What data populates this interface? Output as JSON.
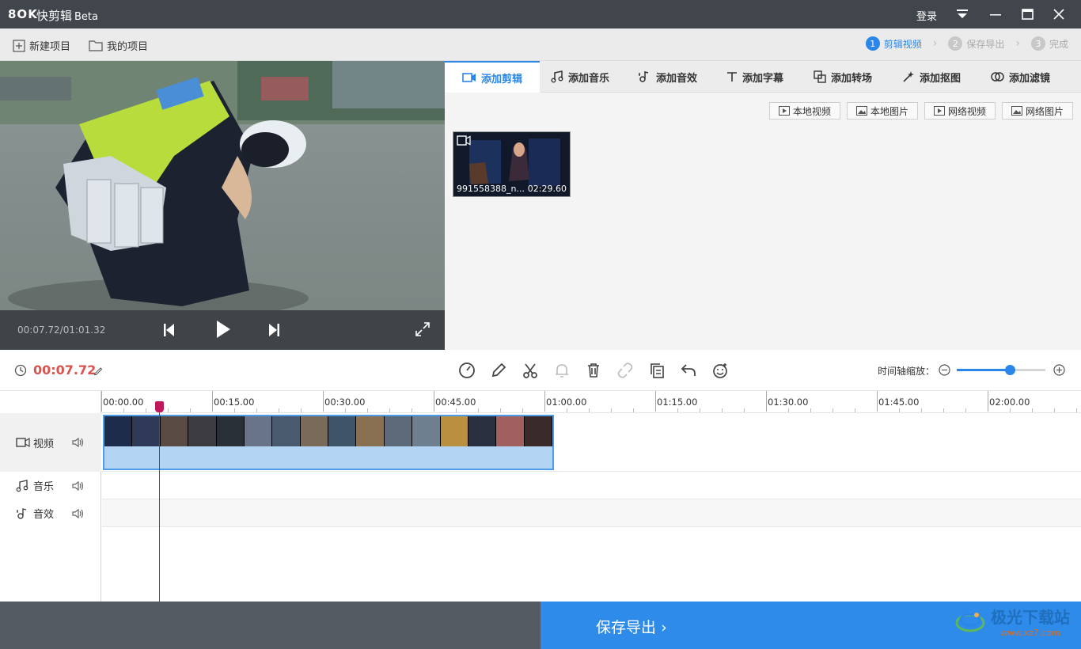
{
  "titlebar": {
    "logo": "8OK",
    "app_name": "快剪辑",
    "beta": "Beta",
    "login": "登录"
  },
  "menubar": {
    "new_project": "新建项目",
    "my_projects": "我的项目",
    "steps": [
      {
        "num": "1",
        "label": "剪辑视频"
      },
      {
        "num": "2",
        "label": "保存导出"
      },
      {
        "num": "3",
        "label": "完成"
      }
    ]
  },
  "preview": {
    "time": "00:07.72/01:01.32"
  },
  "tabs": [
    {
      "label": "添加剪辑",
      "icon": "video-camera-icon"
    },
    {
      "label": "添加音乐",
      "icon": "music-note-icon"
    },
    {
      "label": "添加音效",
      "icon": "sound-effect-icon"
    },
    {
      "label": "添加字幕",
      "icon": "text-icon"
    },
    {
      "label": "添加转场",
      "icon": "transition-icon"
    },
    {
      "label": "添加抠图",
      "icon": "magic-wand-icon"
    },
    {
      "label": "添加滤镜",
      "icon": "filter-icon"
    }
  ],
  "sources": {
    "local_video": "本地视频",
    "local_image": "本地图片",
    "web_video": "网络视频",
    "web_image": "网络图片"
  },
  "media_clip": {
    "name": "991558388_n...",
    "duration": "02:29.60"
  },
  "edit": {
    "current_time": "00:07.72",
    "zoom_label": "时间轴缩放：",
    "zoom_level": 0.6
  },
  "ruler": {
    "labels": [
      "00:00.00",
      "00:15.00",
      "00:30.00",
      "00:45.00",
      "01:00.00",
      "01:15.00",
      "01:30.00",
      "01:45.00",
      "02:00.00"
    ]
  },
  "tracks": {
    "video": "视频",
    "music": "音乐",
    "sfx": "音效"
  },
  "export": {
    "label": "保存导出"
  },
  "watermark": {
    "title": "极光下载站",
    "url": "www.xz7.com"
  },
  "colors": {
    "accent": "#2a86e8",
    "time_red": "#d9534f",
    "playhead": "#c2185b"
  }
}
